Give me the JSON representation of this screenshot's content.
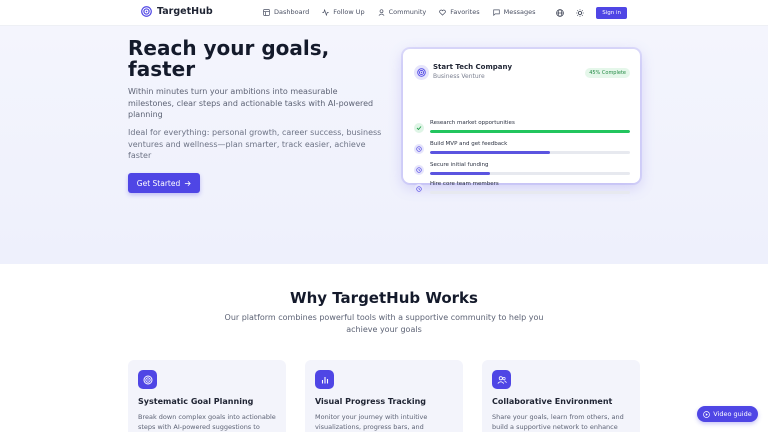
{
  "nav": {
    "brand": "TargetHub",
    "links": [
      {
        "label": "Dashboard",
        "icon": "layout-icon"
      },
      {
        "label": "Follow Up",
        "icon": "activity-icon"
      },
      {
        "label": "Community",
        "icon": "user-icon"
      },
      {
        "label": "Favorites",
        "icon": "heart-icon"
      },
      {
        "label": "Messages",
        "icon": "message-icon"
      }
    ],
    "signin_label": "Sign in"
  },
  "hero": {
    "title": "Reach your goals, faster",
    "subtitle": "Within minutes turn your ambitions into measurable milestones, clear steps and actionable tasks with AI-powered planning",
    "subtitle2": "Ideal for everything: personal growth, career success, business ventures and wellness—plan smarter, track easier, achieve faster",
    "cta_label": "Get Started"
  },
  "card": {
    "title": "Start Tech Company",
    "subtitle": "Business Venture",
    "badge": "45% Complete",
    "tasks": [
      {
        "label": "Research market opportunities",
        "progress": 1.0,
        "status": "done"
      },
      {
        "label": "Build MVP and get feedback",
        "progress": 0.6,
        "status": "in-progress"
      },
      {
        "label": "Secure initial funding",
        "progress": 0.3,
        "status": "in-progress"
      },
      {
        "label": "Hire core team members",
        "progress": 0.0,
        "status": "pending"
      }
    ]
  },
  "why": {
    "title": "Why TargetHub Works",
    "subtitle": "Our platform combines powerful tools with a supportive community to help you achieve your goals"
  },
  "features": [
    {
      "title": "Systematic Goal Planning",
      "desc": "Break down complex goals into actionable steps with AI-powered suggestions to",
      "icon": "target-icon"
    },
    {
      "title": "Visual Progress Tracking",
      "desc": "Monitor your journey with intuitive visualizations, progress bars, and",
      "icon": "bar-chart-icon"
    },
    {
      "title": "Collaborative Environment",
      "desc": "Share your goals, learn from others, and build a supportive network to enhance",
      "icon": "users-icon"
    }
  ],
  "video_label": "Video guide",
  "colors": {
    "accent": "#4f46e5",
    "success": "#22c55e",
    "progress": "#5b54e0"
  }
}
